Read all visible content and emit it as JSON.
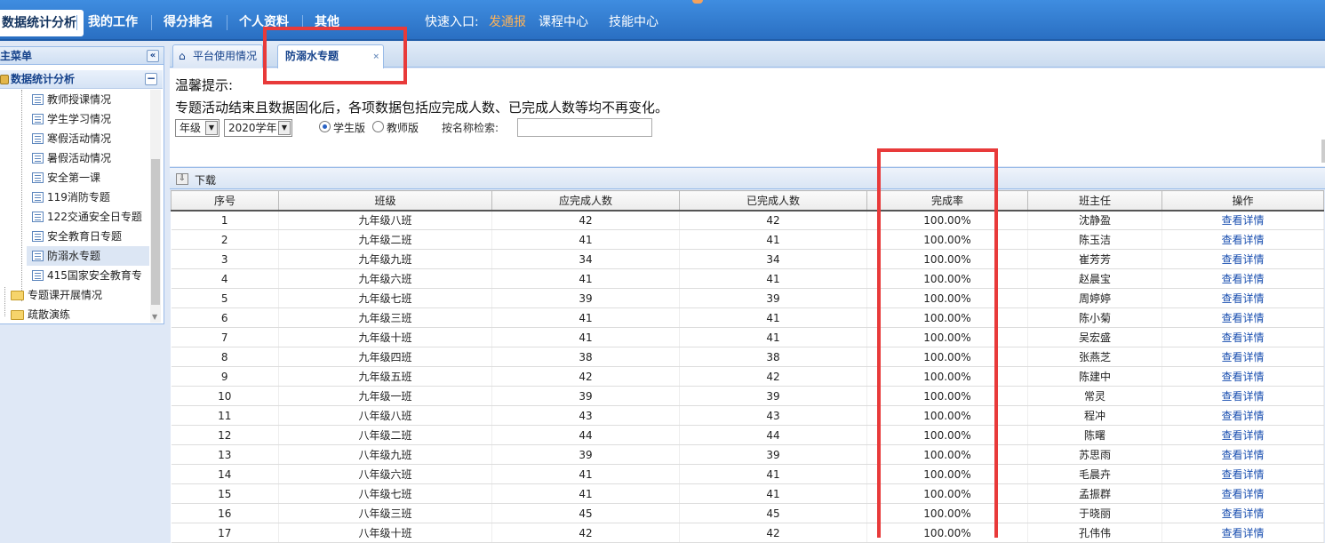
{
  "topnav": {
    "items": [
      "数据统计分析",
      "我的工作",
      "得分排名",
      "个人资料",
      "其他"
    ],
    "quick_label": "快速入口:",
    "quick_links": [
      "发通报",
      "课程中心",
      "技能中心"
    ]
  },
  "sidebar": {
    "title": "主菜单",
    "collapse_glyph": "«",
    "group_label": "数据统计分析",
    "group_toggle": "−",
    "items": [
      "教师授课情况",
      "学生学习情况",
      "寒假活动情况",
      "暑假活动情况",
      "安全第一课",
      "119消防专题",
      "122交通安全日专题",
      "安全教育日专题",
      "防溺水专题",
      "415国家安全教育专"
    ],
    "folders": [
      "专题课开展情况",
      "疏散演练"
    ],
    "selected_index": 8
  },
  "tabs": {
    "items": [
      "平台使用情况",
      "防溺水专题"
    ],
    "active_index": 1,
    "close_glyph": "×"
  },
  "notice": {
    "title": "温馨提示:",
    "message": "专题活动结束且数据固化后，各项数据包括应完成人数、已完成人数等均不再变化。"
  },
  "filters": {
    "grade_select": "年级",
    "year_select": "2020学年",
    "radio_student": "学生版",
    "radio_teacher": "教师版",
    "radio_selected": "学生版",
    "search_label": "按名称检索:",
    "search_value": ""
  },
  "toolbar": {
    "download_label": "下载"
  },
  "table": {
    "columns": [
      "序号",
      "班级",
      "应完成人数",
      "已完成人数",
      "完成率",
      "班主任",
      "操作"
    ],
    "rows": [
      [
        "1",
        "九年级八班",
        "42",
        "42",
        "100.00%",
        "沈静盈",
        "查看详情"
      ],
      [
        "2",
        "九年级二班",
        "41",
        "41",
        "100.00%",
        "陈玉洁",
        "查看详情"
      ],
      [
        "3",
        "九年级九班",
        "34",
        "34",
        "100.00%",
        "崔芳芳",
        "查看详情"
      ],
      [
        "4",
        "九年级六班",
        "41",
        "41",
        "100.00%",
        "赵晨宝",
        "查看详情"
      ],
      [
        "5",
        "九年级七班",
        "39",
        "39",
        "100.00%",
        "周婷婷",
        "查看详情"
      ],
      [
        "6",
        "九年级三班",
        "41",
        "41",
        "100.00%",
        "陈小菊",
        "查看详情"
      ],
      [
        "7",
        "九年级十班",
        "41",
        "41",
        "100.00%",
        "吴宏盛",
        "查看详情"
      ],
      [
        "8",
        "九年级四班",
        "38",
        "38",
        "100.00%",
        "张燕芝",
        "查看详情"
      ],
      [
        "9",
        "九年级五班",
        "42",
        "42",
        "100.00%",
        "陈建中",
        "查看详情"
      ],
      [
        "10",
        "九年级一班",
        "39",
        "39",
        "100.00%",
        "常灵",
        "查看详情"
      ],
      [
        "11",
        "八年级八班",
        "43",
        "43",
        "100.00%",
        "程冲",
        "查看详情"
      ],
      [
        "12",
        "八年级二班",
        "44",
        "44",
        "100.00%",
        "陈曙",
        "查看详情"
      ],
      [
        "13",
        "八年级九班",
        "39",
        "39",
        "100.00%",
        "苏思雨",
        "查看详情"
      ],
      [
        "14",
        "八年级六班",
        "41",
        "41",
        "100.00%",
        "毛晨卉",
        "查看详情"
      ],
      [
        "15",
        "八年级七班",
        "41",
        "41",
        "100.00%",
        "孟振群",
        "查看详情"
      ],
      [
        "16",
        "八年级三班",
        "45",
        "45",
        "100.00%",
        "于晓丽",
        "查看详情"
      ],
      [
        "17",
        "八年级十班",
        "42",
        "42",
        "100.00%",
        "孔伟伟",
        "查看详情"
      ]
    ]
  }
}
